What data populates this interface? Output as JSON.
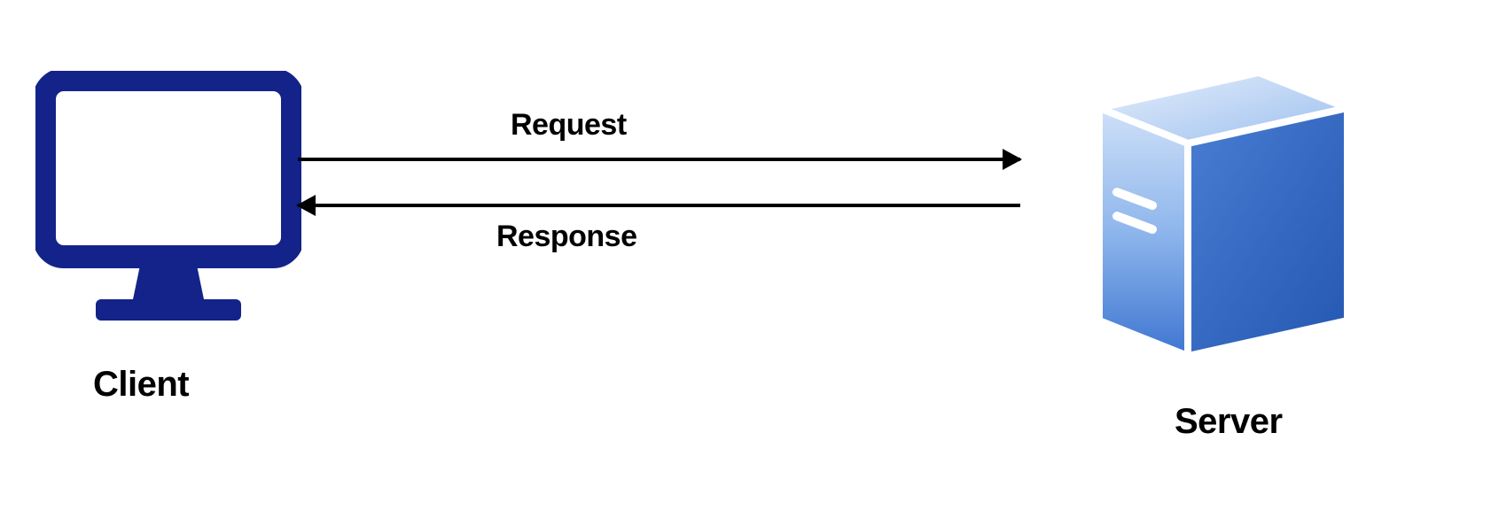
{
  "diagram": {
    "client_label": "Client",
    "server_label": "Server",
    "request_label": "Request",
    "response_label": "Response"
  },
  "colors": {
    "client_stroke": "#13238A",
    "server_light": "#B8CFF3",
    "server_mid": "#6FA1E6",
    "server_dark": "#3E75D1",
    "server_edge": "#1F4FA8",
    "arrow": "#000000"
  }
}
